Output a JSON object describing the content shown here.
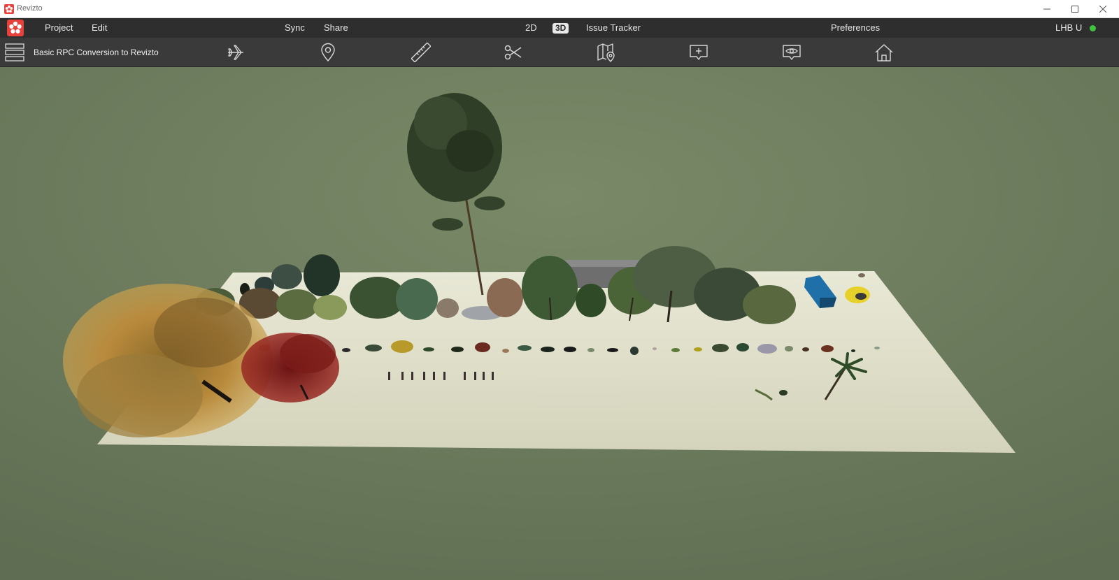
{
  "window": {
    "title": "Revizto",
    "controls": [
      "minimize-icon",
      "maximize-icon",
      "close-icon"
    ]
  },
  "menubar": {
    "project": "Project",
    "edit": "Edit",
    "sync": "Sync",
    "share": "Share",
    "view_2d": "2D",
    "view_3d": "3D",
    "issue_tracker": "Issue Tracker",
    "preferences": "Preferences",
    "user": "LHB U",
    "status_color": "#3fc23f"
  },
  "toolbar": {
    "project_name": "Basic RPC Conversion to Revizto",
    "tools": [
      "fly-icon",
      "location-pin-icon",
      "ruler-icon",
      "scissors-icon",
      "map-location-icon",
      "add-comment-icon",
      "eye-icon",
      "home-icon"
    ]
  },
  "colors": {
    "accent": "#e8403a",
    "menubar_bg": "#2e2e2e",
    "toolbar_bg": "#3a3a3a",
    "viewport_bg": "#6b7a5c",
    "ground_plane": "#dcdcc6"
  }
}
